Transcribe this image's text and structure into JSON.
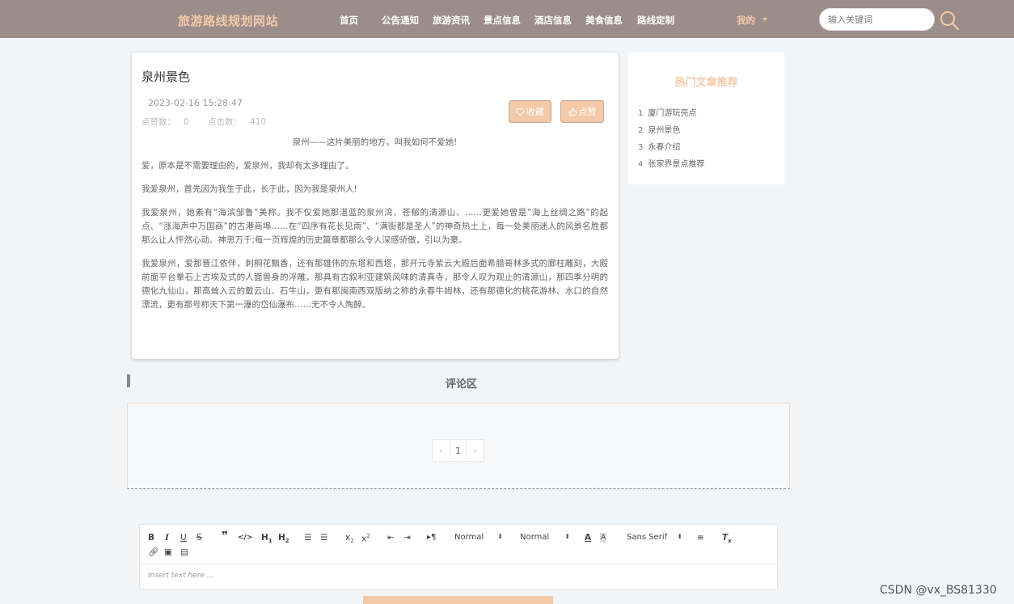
{
  "nav": {
    "site_title": "旅游路线规划网站",
    "menu": [
      "首页",
      "公告通知",
      "旅游资讯",
      "景点信息",
      "酒店信息",
      "美食信息",
      "路线定制"
    ],
    "mine": "我的",
    "search_placeholder": "输入关键词"
  },
  "article": {
    "title": "泉州景色",
    "date": "2023-02-16 15:28:47",
    "likes_label": "点赞数：",
    "likes": "0",
    "clicks_label": "点击数：",
    "clicks": "410",
    "fav_label": "收藏",
    "like_label": "点赞",
    "paragraphs": [
      "泉州——这片美丽的地方，叫我如何不爱她!",
      "爱，原本是不需要理由的，爱泉州，我却有太多理由了。",
      "我爱泉州，首先因为我生于此，长于此，因为我是泉州人!",
      "我爱泉州，她素有“海滨邹鲁”美称。我不仅爱她那湛蓝的泉州湾、苍郁的清源山、……更爱她曾是“海上丝绸之路”的起点、“涨海声中万国商”的古港商埠……在“四序有花长见雨”、“满街都是圣人”的神奇热土上，每一处美丽迷人的风景名胜都那么让人怦然心动、神思万千;每一页辉煌的历史篇章都那么令人深感骄傲，引以为豪。",
      "我爱泉州，爱那晋江依伴，刺桐花飘香，还有那雄伟的东塔和西塔，那开元寺紫云大殿后面希腊哥林多式的廊柱雕刻，大殿前面平台拳石上古埃及式的人面兽身的浮雕，那具有古叙利亚建筑风味的清真寺，那令人叹为观止的清源山，那四季分明的德化九仙山，那高耸入云的戴云山、石牛山，更有那闽南西双版纳之称的永春牛姆林，还有那德化的桃花游林、水口的自然漂流，更有那号称天下第一瀑的岱仙瀑布……无不令人陶醉。"
    ]
  },
  "hot": {
    "title": "热门文章推荐",
    "items": [
      {
        "num": "1",
        "label": "厦门游玩亮点"
      },
      {
        "num": "2",
        "label": "泉州景色"
      },
      {
        "num": "3",
        "label": "永春介绍"
      },
      {
        "num": "4",
        "label": "张家界景点推荐"
      }
    ]
  },
  "comments": {
    "title": "评论区",
    "prev": "‹",
    "page": "1",
    "next": "›"
  },
  "editor": {
    "header_select": "Normal",
    "size_select": "Normal",
    "font_select": "Sans Serif",
    "placeholder": "Insert text here ..."
  },
  "watermark": "CSDN @vx_BS81330"
}
